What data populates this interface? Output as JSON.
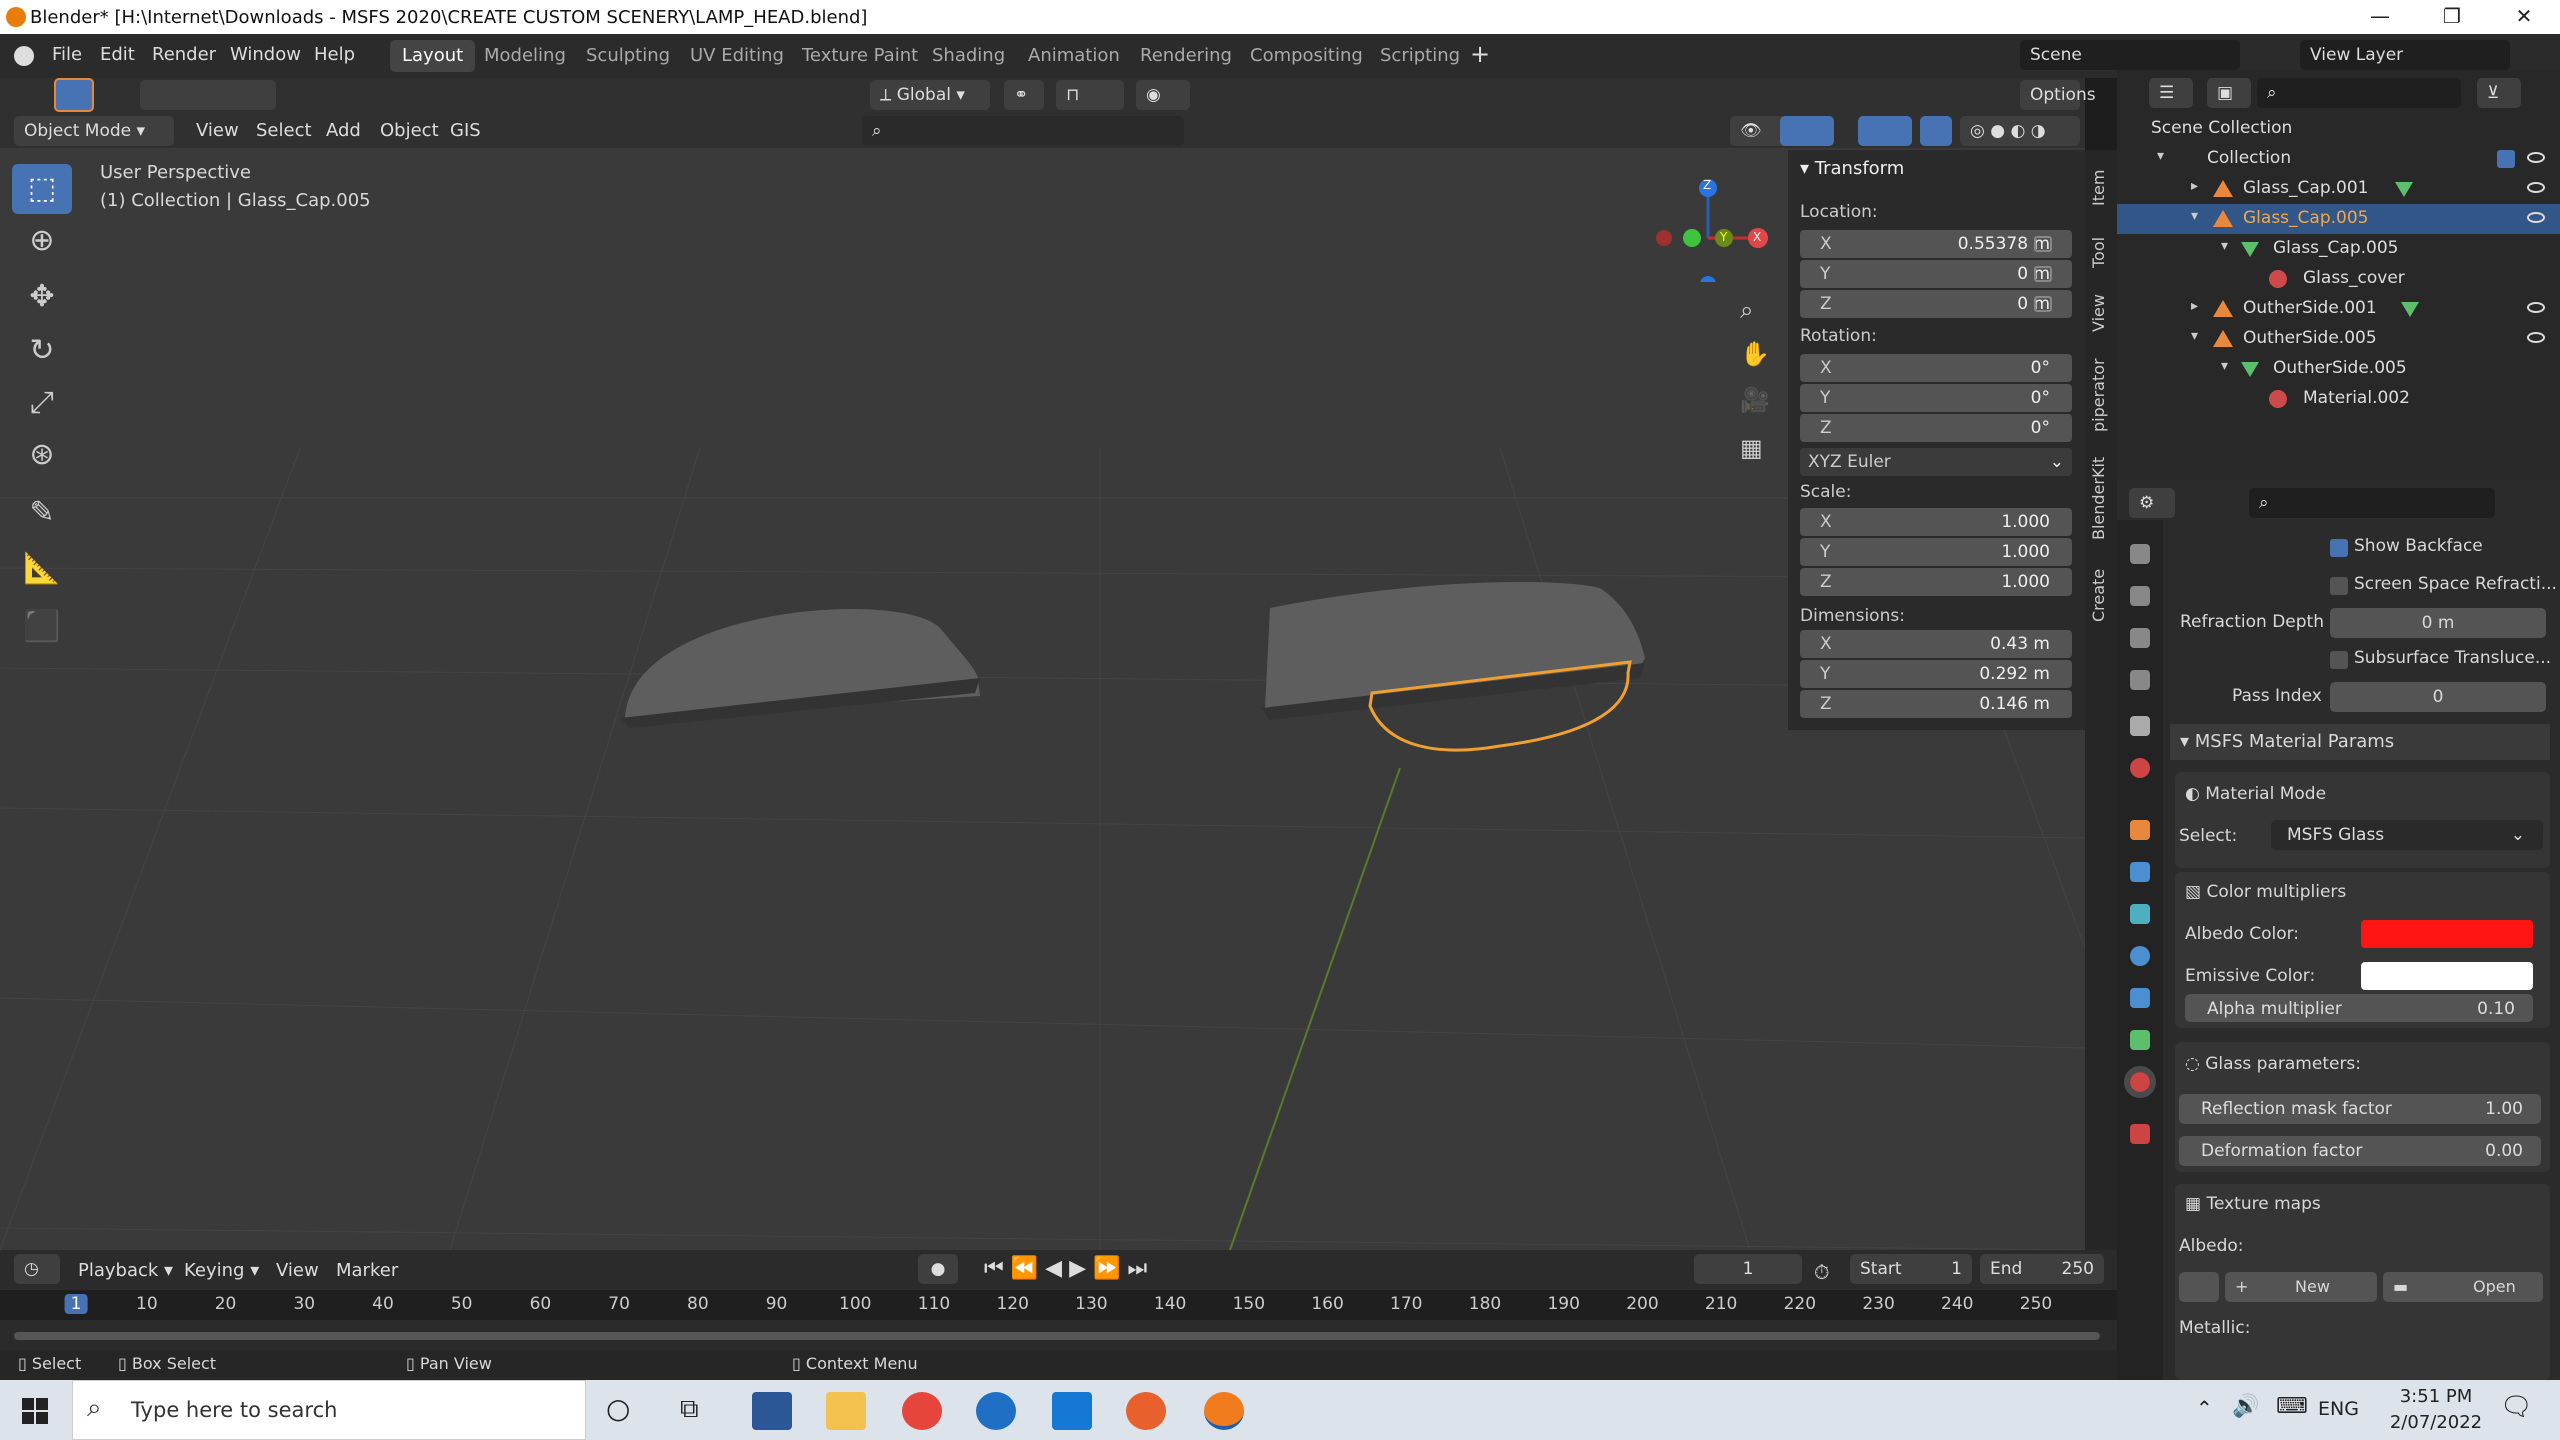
{
  "window": {
    "title": "Blender* [H:\\Internet\\Downloads - MSFS 2020\\CREATE CUSTOM SCENERY\\LAMP_HEAD.blend]",
    "min": "—",
    "max": "❐",
    "close": "✕"
  },
  "menus": [
    "File",
    "Edit",
    "Render",
    "Window",
    "Help"
  ],
  "workspaces": [
    "Layout",
    "Modeling",
    "Sculpting",
    "UV Editing",
    "Texture Paint",
    "Shading",
    "Animation",
    "Rendering",
    "Compositing",
    "Scripting"
  ],
  "scene": "Scene",
  "view_layer": "View Layer",
  "header": {
    "mode": "Object Mode",
    "menus": [
      "View",
      "Select",
      "Add",
      "Object",
      "GIS"
    ],
    "orientation": "Global",
    "options": "Options"
  },
  "viewport": {
    "line1": "User Perspective",
    "line2": "(1) Collection | Glass_Cap.005"
  },
  "gizmo": {
    "z": "Z",
    "y": "Y",
    "x": "X"
  },
  "transform": {
    "title": "Transform",
    "location_label": "Location:",
    "loc": [
      {
        "axis": "X",
        "value": "0.55378 m"
      },
      {
        "axis": "Y",
        "value": "0 m"
      },
      {
        "axis": "Z",
        "value": "0 m"
      }
    ],
    "rotation_label": "Rotation:",
    "rot": [
      {
        "axis": "X",
        "value": "0°"
      },
      {
        "axis": "Y",
        "value": "0°"
      },
      {
        "axis": "Z",
        "value": "0°"
      }
    ],
    "euler": "XYZ Euler",
    "scale_label": "Scale:",
    "scale": [
      {
        "axis": "X",
        "value": "1.000"
      },
      {
        "axis": "Y",
        "value": "1.000"
      },
      {
        "axis": "Z",
        "value": "1.000"
      }
    ],
    "dim_label": "Dimensions:",
    "dim": [
      {
        "axis": "X",
        "value": "0.43 m"
      },
      {
        "axis": "Y",
        "value": "0.292 m"
      },
      {
        "axis": "Z",
        "value": "0.146 m"
      }
    ]
  },
  "side_tabs": [
    "Item",
    "Tool",
    "View",
    "piperator",
    "BlenderKit",
    "Create"
  ],
  "outliner": {
    "root": "Scene Collection",
    "items": [
      {
        "label": "Collection"
      },
      {
        "label": "Glass_Cap.001"
      },
      {
        "label": "Glass_Cap.005"
      },
      {
        "label": "Glass_Cap.005"
      },
      {
        "label": "Glass_cover"
      },
      {
        "label": "OutherSide.001"
      },
      {
        "label": "OutherSide.005"
      },
      {
        "label": "OutherSide.005"
      },
      {
        "label": "Material.002"
      }
    ]
  },
  "props": {
    "show_backface": "Show Backface",
    "ssr": "Screen Space Refracti...",
    "refraction_depth_label": "Refraction Depth",
    "refraction_depth": "0 m",
    "subsurface": "Subsurface Transluce...",
    "pass_index_label": "Pass Index",
    "pass_index": "0",
    "msfs_title": "MSFS Material Params",
    "material_mode": "Material Mode",
    "select_label": "Select:",
    "select_value": "MSFS Glass",
    "color_mult": "Color multipliers",
    "albedo_label": "Albedo Color:",
    "albedo_color": "#ff1414",
    "emissive_label": "Emissive Color:",
    "emissive_color": "#ffffff",
    "alpha_label": "Alpha multiplier",
    "alpha_value": "0.10",
    "glass_params": "Glass parameters:",
    "refl_label": "Reflection mask factor",
    "refl_value": "1.00",
    "deform_label": "Deformation factor",
    "deform_value": "0.00",
    "texture_maps": "Texture maps",
    "albedo_tex": "Albedo:",
    "new_btn": "New",
    "open_btn": "Open",
    "metallic": "Metallic:"
  },
  "timeline": {
    "menus": [
      "Playback",
      "Keying",
      "View",
      "Marker"
    ],
    "frame": "1",
    "start_label": "Start",
    "start": "1",
    "end_label": "End",
    "end": "250",
    "ticks": [
      "1",
      "10",
      "20",
      "30",
      "40",
      "50",
      "60",
      "70",
      "80",
      "90",
      "100",
      "110",
      "120",
      "130",
      "140",
      "150",
      "160",
      "170",
      "180",
      "190",
      "200",
      "210",
      "220",
      "230",
      "240",
      "250"
    ]
  },
  "status": {
    "select": "Select",
    "box_select": "Box Select",
    "pan": "Pan View",
    "context": "Context Menu"
  },
  "taskbar": {
    "search": "Type here to search",
    "lang": "ENG",
    "time": "3:51 PM",
    "date": "2/07/2022"
  }
}
